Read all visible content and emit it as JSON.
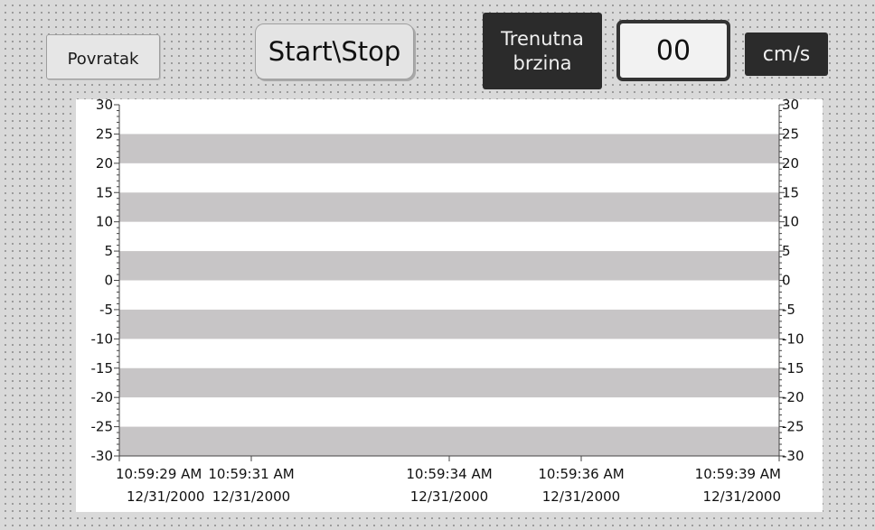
{
  "buttons": {
    "back": "Povratak",
    "start_stop": "Start\\Stop"
  },
  "speed": {
    "label_line1": "Trenutna",
    "label_line2": "brzina",
    "value": "00",
    "unit": "cm/s"
  },
  "chart_data": {
    "type": "line",
    "y_ticks": [
      30,
      25,
      20,
      15,
      10,
      5,
      0,
      -5,
      -10,
      -15,
      -20,
      -25,
      -30
    ],
    "ylim": [
      -30,
      30
    ],
    "band_pairs": [
      [
        25,
        20
      ],
      [
        15,
        10
      ],
      [
        5,
        0
      ],
      [
        -5,
        -10
      ],
      [
        -15,
        -20
      ],
      [
        -25,
        -30
      ]
    ],
    "band_color": "#c7c5c6",
    "x_labels": [
      {
        "time": "10:59:29 AM",
        "date": "12/31/2000"
      },
      {
        "time": "10:59:31 AM",
        "date": "12/31/2000"
      },
      {
        "time": "10:59:34 AM",
        "date": "12/31/2000"
      },
      {
        "time": "10:59:36 AM",
        "date": "12/31/2000"
      },
      {
        "time": "10:59:39 AM",
        "date": "12/31/2000"
      }
    ],
    "x_values": [
      29,
      31,
      34,
      36,
      39
    ],
    "xlim": [
      29,
      39
    ],
    "series": []
  }
}
